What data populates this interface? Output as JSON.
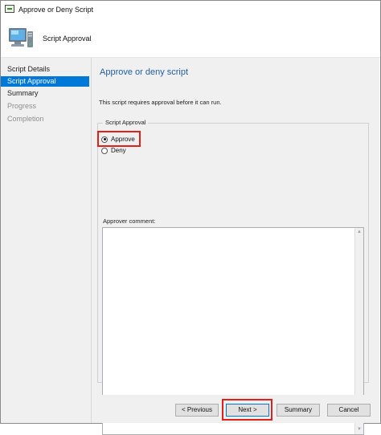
{
  "window": {
    "title": "Approve or Deny Script"
  },
  "header": {
    "title": "Script Approval",
    "icon": "computer-icon"
  },
  "sidebar": {
    "items": [
      {
        "label": "Script Details",
        "state": "normal"
      },
      {
        "label": "Script Approval",
        "state": "active"
      },
      {
        "label": "Summary",
        "state": "normal"
      },
      {
        "label": "Progress",
        "state": "disabled"
      },
      {
        "label": "Completion",
        "state": "disabled"
      }
    ]
  },
  "main": {
    "heading": "Approve or deny script",
    "description": "This script requires approval before it can run.",
    "group_label": "Script Approval",
    "approve_label": "Approve",
    "deny_label": "Deny",
    "selected": "Approve",
    "comment_label": "Approver comment:",
    "comment_value": ""
  },
  "buttons": {
    "previous": "< Previous",
    "next": "Next >",
    "summary": "Summary",
    "cancel": "Cancel"
  },
  "colors": {
    "accent": "#0078d7",
    "heading": "#1f5fa6",
    "highlight": "#e0201b",
    "panel": "#f0f0f0"
  }
}
